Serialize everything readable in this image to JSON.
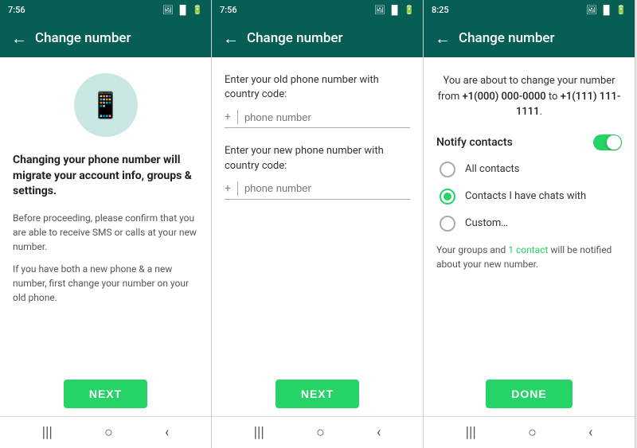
{
  "screen1": {
    "time": "7:56",
    "toolbar_title": "Change number",
    "heading": "Changing your phone number will migrate your account info, groups & settings.",
    "para1": "Before proceeding, please confirm that you are able to receive SMS or calls at your new number.",
    "para2": "If you have both a new phone & a new number, first change your number on your old phone.",
    "next_btn": "NEXT",
    "back_arrow": "←"
  },
  "screen2": {
    "time": "7:56",
    "toolbar_title": "Change number",
    "old_label": "Enter your old phone number with country code:",
    "new_label": "Enter your new phone number with country code:",
    "phone_placeholder": "phone number",
    "next_btn": "NEXT",
    "back_arrow": "←",
    "plus": "+"
  },
  "screen3": {
    "time": "8:25",
    "toolbar_title": "Change number",
    "change_desc_prefix": "You are about to change your number from ",
    "old_number": "+1(000) 000-0000",
    "change_desc_mid": " to ",
    "new_number": "+1(111) 111-1111",
    "change_desc_suffix": ".",
    "notify_label": "Notify contacts",
    "radio1": "All contacts",
    "radio2": "Contacts I have chats with",
    "radio3": "Custom…",
    "groups_note_pre": "Your groups and ",
    "groups_link": "1 contact",
    "groups_note_post": " will be notified about your new number.",
    "done_btn": "DONE",
    "back_arrow": "←"
  },
  "nav": {
    "menu": "|||",
    "home": "○",
    "back": "‹"
  },
  "colors": {
    "teal": "#075E54",
    "green": "#25D366",
    "bg_icon": "#c8e6e2"
  }
}
